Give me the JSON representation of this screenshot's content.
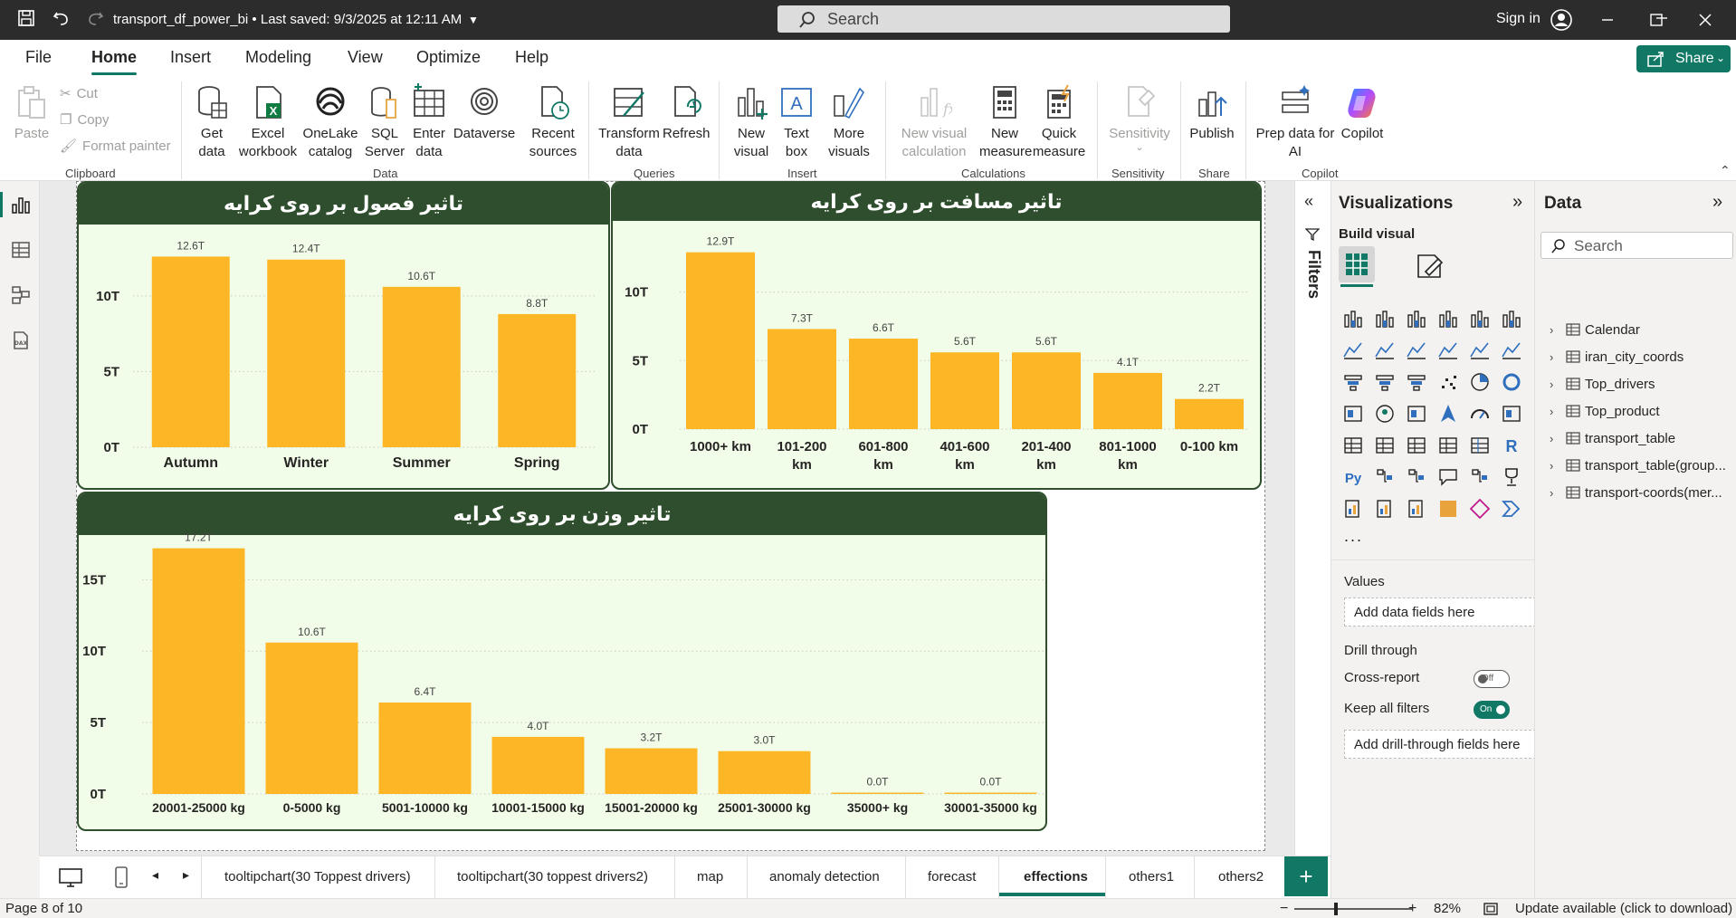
{
  "titlebar": {
    "title": "transport_df_power_bi • Last saved: 9/3/2025 at 12:11 AM",
    "search": "Search",
    "signin": "Sign in"
  },
  "menu": {
    "tabs": [
      "File",
      "Home",
      "Insert",
      "Modeling",
      "View",
      "Optimize",
      "Help"
    ],
    "active": "Home",
    "share": "Share"
  },
  "ribbon": {
    "clipboard": {
      "paste": "Paste",
      "cut": "Cut",
      "copy": "Copy",
      "format_painter": "Format painter",
      "group": "Clipboard"
    },
    "data": {
      "get_data": "Get\ndata",
      "excel": "Excel\nworkbook",
      "onelake": "OneLake\ncatalog",
      "sql": "SQL\nServer",
      "enter": "Enter\ndata",
      "dataverse": "Dataverse",
      "recent": "Recent\nsources",
      "group": "Data"
    },
    "queries": {
      "transform": "Transform\ndata",
      "refresh": "Refresh",
      "group": "Queries"
    },
    "insert": {
      "new_visual": "New\nvisual",
      "text_box": "Text\nbox",
      "more_visuals": "More\nvisuals",
      "group": "Insert"
    },
    "calculations": {
      "new_visual_calc": "New visual\ncalculation",
      "new_measure": "New\nmeasure",
      "quick_measure": "Quick\nmeasure",
      "group": "Calculations"
    },
    "sensitivity": {
      "label": "Sensitivity",
      "group": "Sensitivity"
    },
    "share": {
      "publish": "Publish",
      "group": "Share"
    },
    "copilot": {
      "prep": "Prep data for\nAI",
      "copilot": "Copilot",
      "group": "Copilot"
    }
  },
  "colors": {
    "bar": "#fdb726",
    "card_header": "#2e4e2d",
    "card_bg": "#f2fde9",
    "accent": "#117865"
  },
  "charts": {
    "seasons": {
      "title": "تاثیر فصول بر روی کرایه"
    },
    "distance": {
      "title": "تاثیر مسافت بر روی کرایه"
    },
    "weight": {
      "title": "تاثیر وزن بر روی کرایه"
    }
  },
  "chart_data": [
    {
      "type": "bar",
      "title": "تاثیر فصول بر روی کرایه",
      "categories": [
        "Autumn",
        "Winter",
        "Summer",
        "Spring"
      ],
      "values": [
        12.6,
        12.4,
        10.6,
        8.8
      ],
      "data_labels": [
        "12.6T",
        "12.4T",
        "10.6T",
        "8.8T"
      ],
      "yticks": [
        "0T",
        "5T",
        "10T"
      ],
      "ylim": [
        0,
        14
      ]
    },
    {
      "type": "bar",
      "title": "تاثیر مسافت بر روی کرایه",
      "categories": [
        "1000+ km",
        "101-200 km",
        "601-800 km",
        "401-600 km",
        "201-400 km",
        "801-1000 km",
        "0-100 km"
      ],
      "values": [
        12.9,
        7.3,
        6.6,
        5.6,
        5.6,
        4.1,
        2.2
      ],
      "data_labels": [
        "12.9T",
        "7.3T",
        "6.6T",
        "5.6T",
        "5.6T",
        "4.1T",
        "2.2T"
      ],
      "yticks": [
        "0T",
        "5T",
        "10T"
      ],
      "ylim": [
        0,
        14
      ]
    },
    {
      "type": "bar",
      "title": "تاثیر وزن بر روی کرایه",
      "categories": [
        "20001-25000 kg",
        "0-5000 kg",
        "5001-10000 kg",
        "10001-15000 kg",
        "15001-20000 kg",
        "25001-30000 kg",
        "35000+ kg",
        "30001-35000 kg"
      ],
      "values": [
        17.2,
        10.6,
        6.4,
        4.0,
        3.2,
        3.0,
        0.0,
        0.0
      ],
      "data_labels": [
        "17.2T",
        "10.6T",
        "6.4T",
        "4.0T",
        "3.2T",
        "3.0T",
        "0.0T",
        "0.0T"
      ],
      "yticks": [
        "0T",
        "5T",
        "10T",
        "15T"
      ],
      "ylim": [
        0,
        18
      ]
    }
  ],
  "filters": {
    "label": "Filters"
  },
  "viz_pane": {
    "title": "Visualizations",
    "build_visual": "Build visual",
    "more": "...",
    "values": "Values",
    "add_data_fields": "Add data fields here",
    "drill_through": "Drill through",
    "cross_report": "Cross-report",
    "cross_report_state": "Off",
    "keep_all_filters": "Keep all filters",
    "keep_all_filters_state": "On",
    "add_drill_fields": "Add drill-through fields here"
  },
  "data_pane": {
    "title": "Data",
    "search": "Search",
    "tables": [
      "Calendar",
      "iran_city_coords",
      "Top_drivers",
      "Top_product",
      "transport_table",
      "transport_table(group...",
      "transport-coords(mer..."
    ]
  },
  "page_tabs": {
    "tabs": [
      "tooltipchart(30 Toppest drivers)",
      "tooltipchart(30 toppest drivers2)",
      "map",
      "anomaly detection",
      "forecast",
      "effections",
      "others1",
      "others2"
    ],
    "active": "effections"
  },
  "status": {
    "page": "Page 8 of 10",
    "zoom": "82%",
    "update": "Update available (click to download)"
  }
}
